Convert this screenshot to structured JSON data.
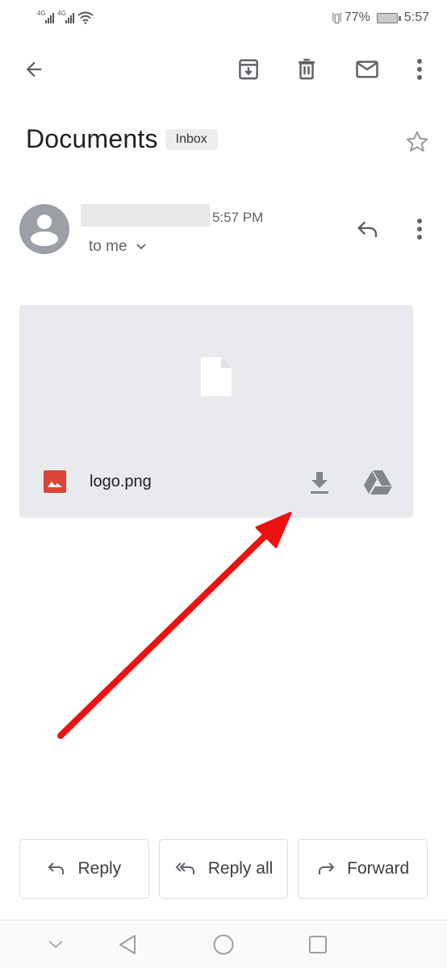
{
  "status_bar": {
    "network_1": "4G",
    "network_2": "4G",
    "battery_percent": "77%",
    "time": "5:57"
  },
  "toolbar": {
    "back_icon": "arrow-back-icon",
    "archive_icon": "archive-icon",
    "delete_icon": "trash-icon",
    "mark_unread_icon": "mail-icon",
    "more_icon": "more-vert-icon"
  },
  "email": {
    "subject": "Documents",
    "label": "Inbox",
    "starred": false,
    "sender_name": "",
    "time": "5:57 PM",
    "recipient": "to me"
  },
  "attachment": {
    "file_name": "logo.png",
    "file_type": "image",
    "type_icon_color": "#db4437",
    "download_icon": "download-icon",
    "drive_icon": "google-drive-icon"
  },
  "annotation": {
    "color": "#ee1111",
    "points_to": "download-button"
  },
  "actions": {
    "reply": "Reply",
    "reply_all": "Reply all",
    "forward": "Forward"
  },
  "nav_bar": {
    "items": [
      "hide-keyboard",
      "back",
      "home",
      "recents"
    ]
  }
}
